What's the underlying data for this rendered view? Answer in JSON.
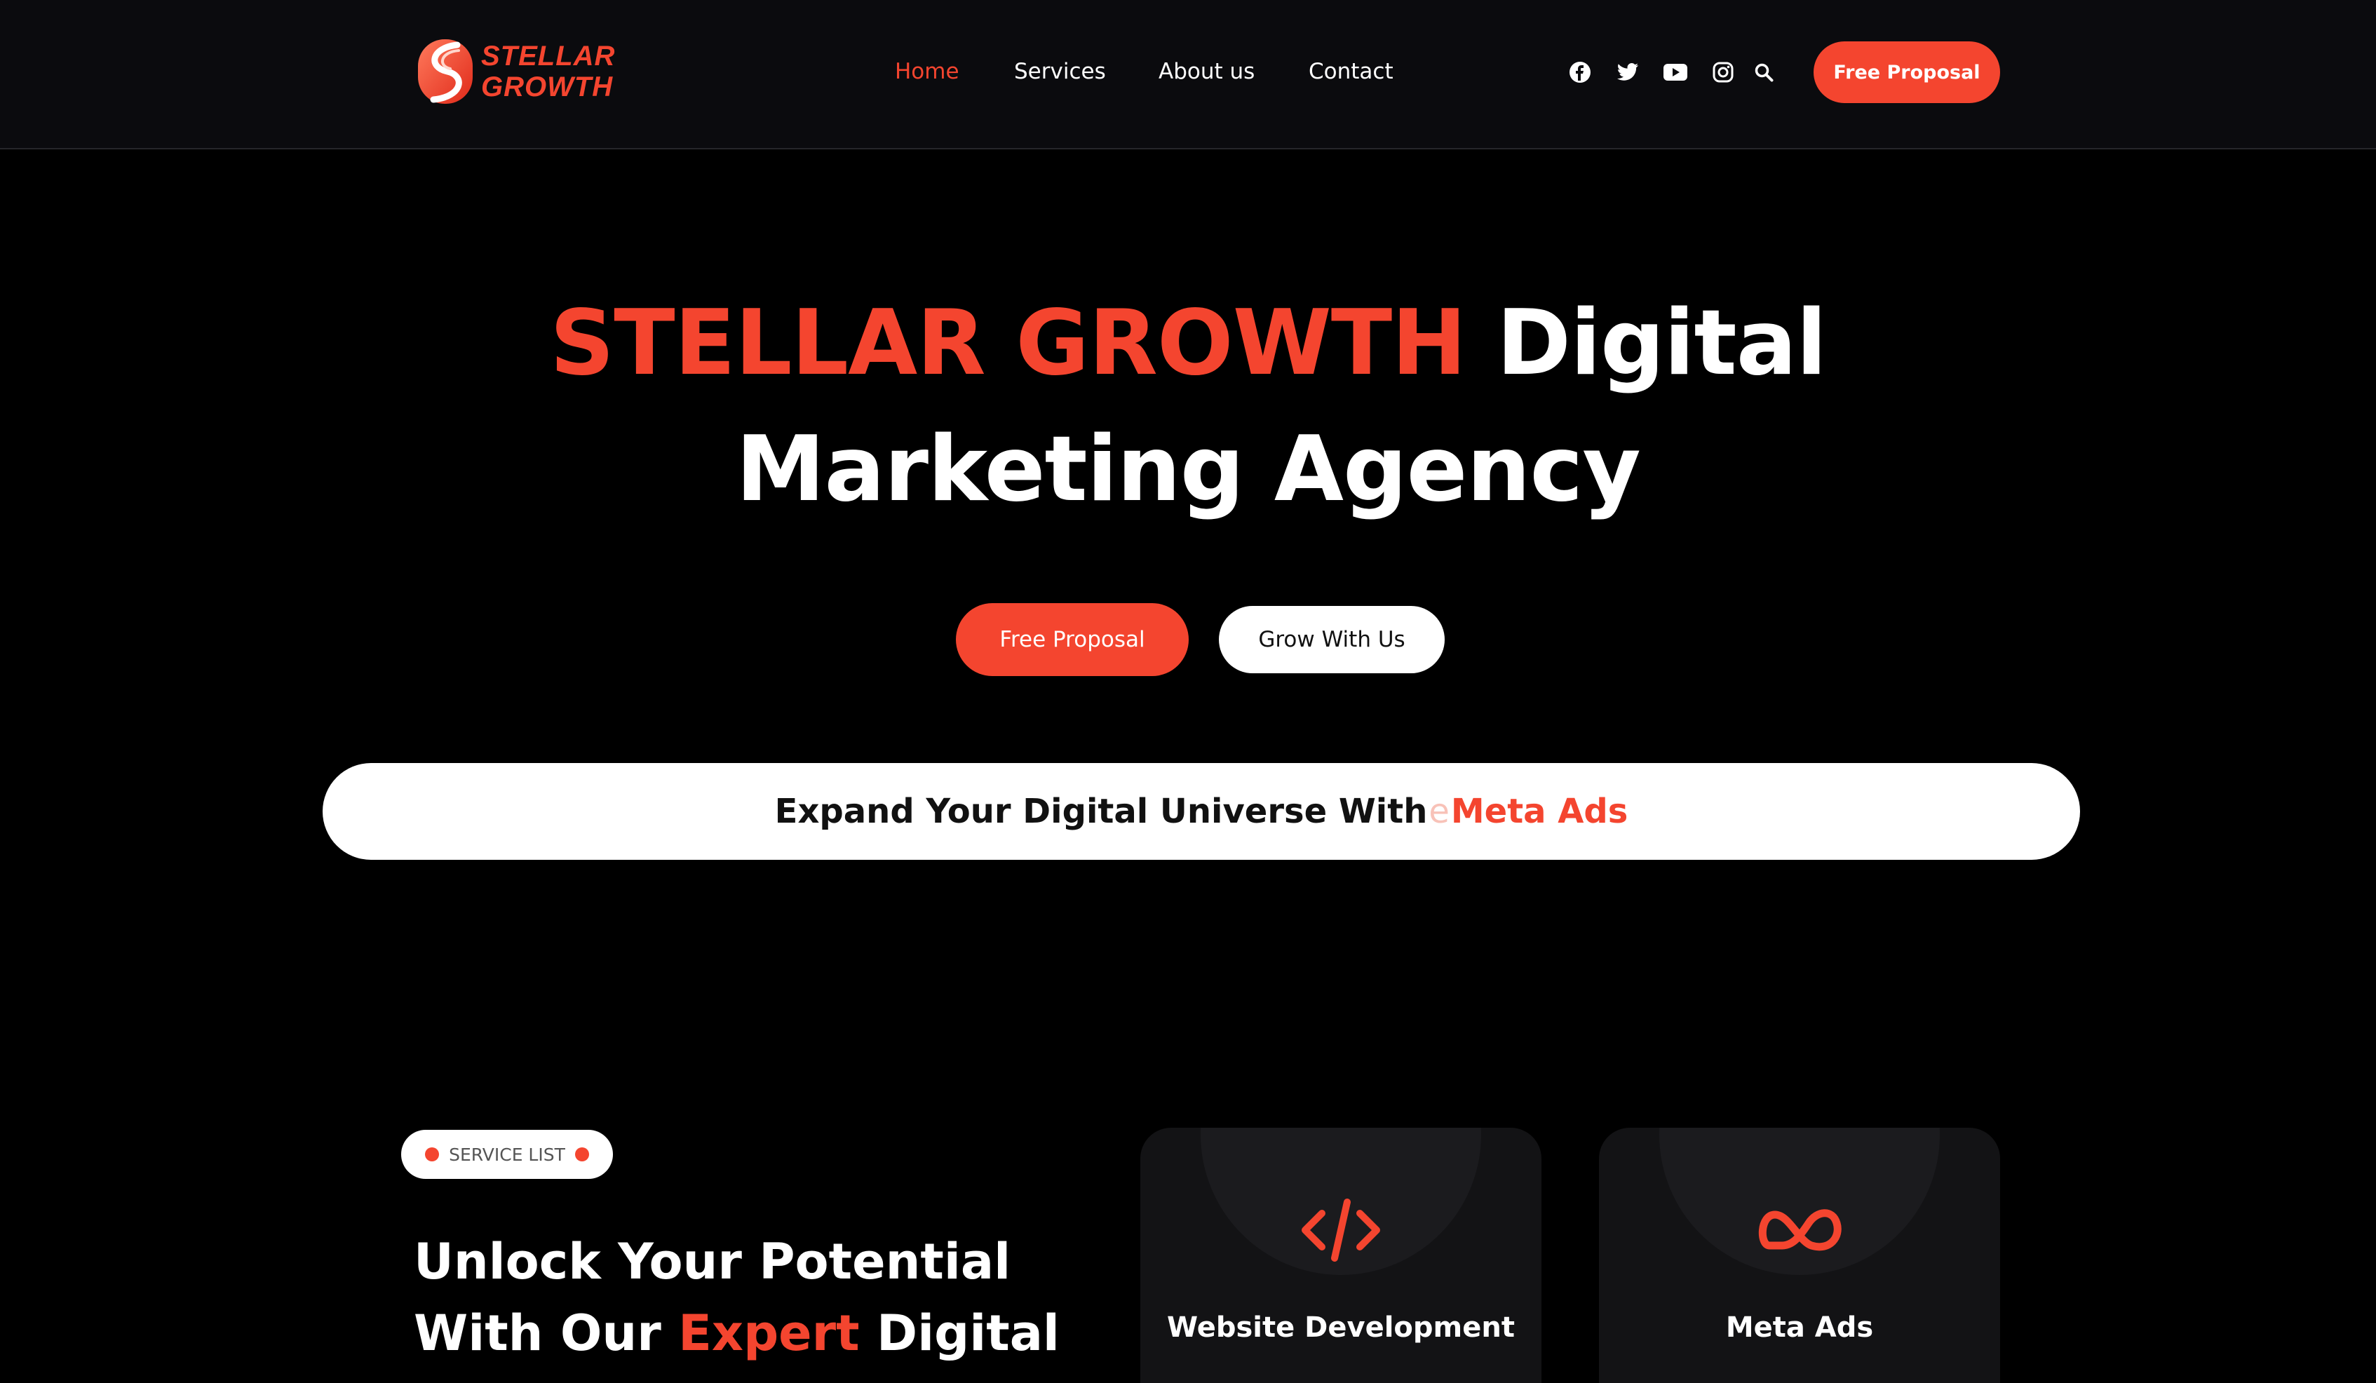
{
  "brand": {
    "name_line1": "STELLAR",
    "name_line2": "GROWTH",
    "accent_color": "#f4452f"
  },
  "nav": {
    "items": [
      {
        "label": "Home",
        "active": true
      },
      {
        "label": "Services",
        "active": false
      },
      {
        "label": "About us",
        "active": false
      },
      {
        "label": "Contact",
        "active": false
      }
    ]
  },
  "social": {
    "icons": [
      "facebook-icon",
      "twitter-icon",
      "youtube-icon",
      "instagram-icon",
      "search-icon"
    ]
  },
  "header": {
    "cta_label": "Free Proposal"
  },
  "hero": {
    "title_accent": "STELLAR GROWTH",
    "title_rest": "Digital",
    "title_line2": "Marketing Agency",
    "primary_button": "Free Proposal",
    "secondary_button": "Grow With Us"
  },
  "ticker": {
    "prefix": "Expand Your Digital Universe With",
    "ghost_letter": "e",
    "highlight": "Meta Ads"
  },
  "services": {
    "badge": "SERVICE LIST",
    "heading_line1": "Unlock Your Potential",
    "heading_line2_pre": "With Our",
    "heading_line2_accent": "Expert",
    "heading_line2_post": "Digital",
    "cards": [
      {
        "icon": "code-icon",
        "label": "Website Development"
      },
      {
        "icon": "meta-icon",
        "label": "Meta Ads"
      }
    ]
  }
}
